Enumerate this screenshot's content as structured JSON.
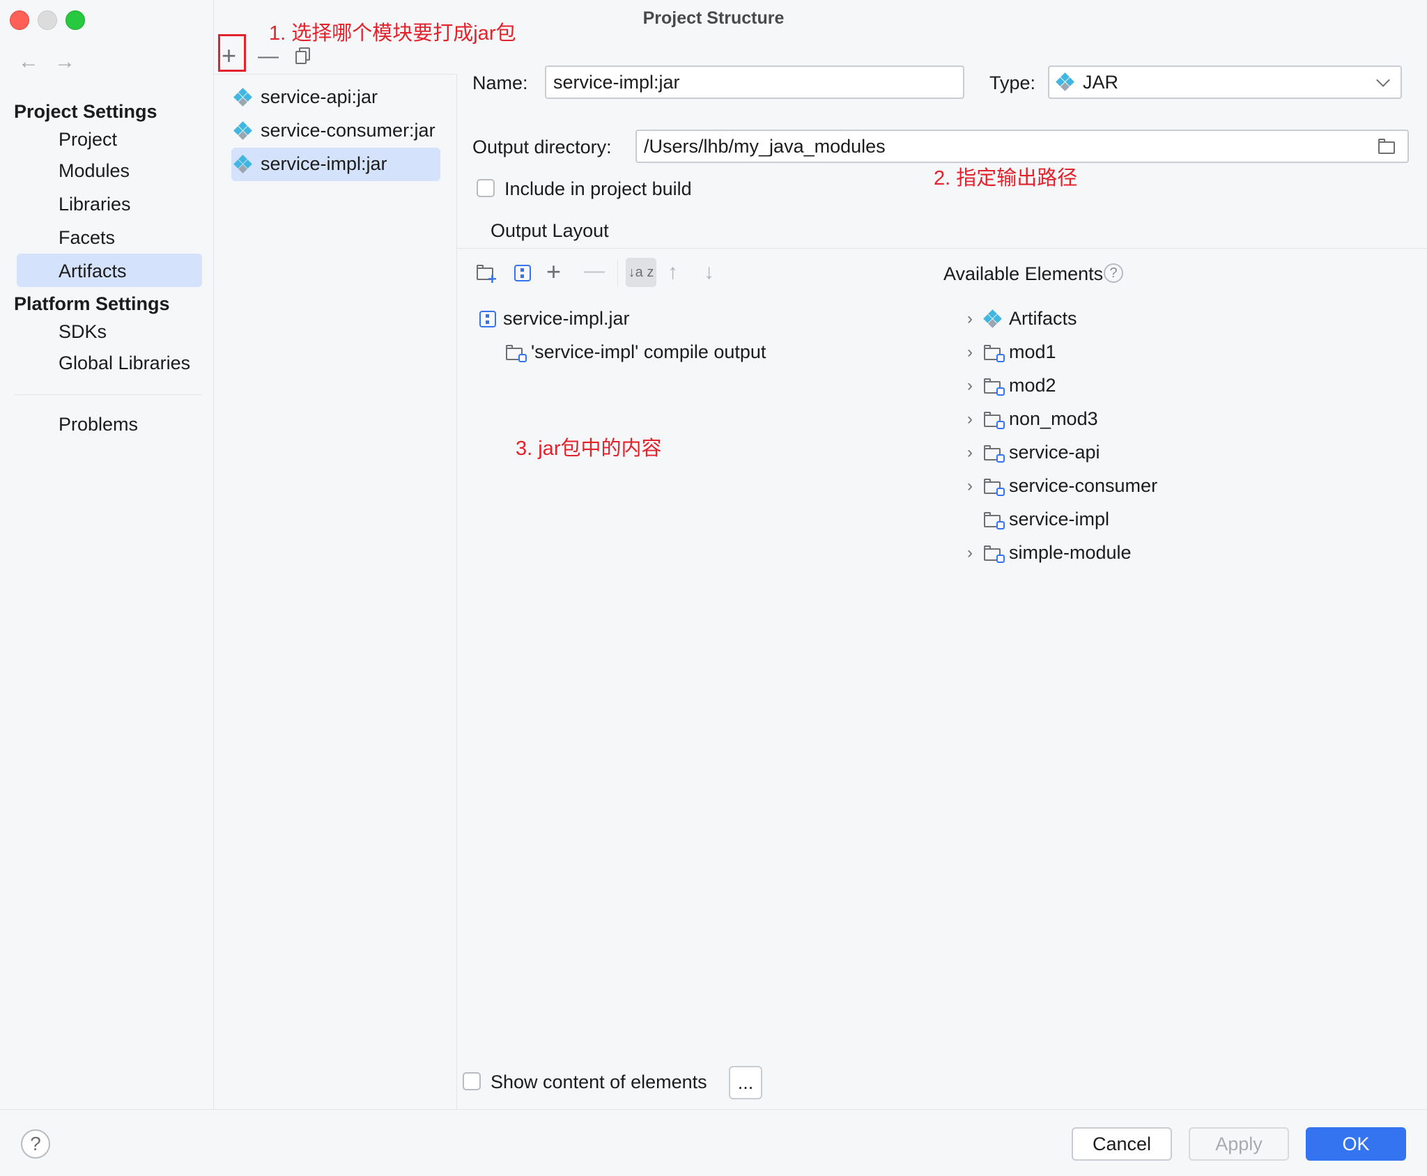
{
  "window": {
    "title": "Project Structure"
  },
  "nav": {
    "back": "←",
    "forward": "→",
    "project_settings": "Project Settings",
    "project_items": [
      "Project",
      "Modules",
      "Libraries",
      "Facets",
      "Artifacts"
    ],
    "platform_settings": "Platform Settings",
    "platform_items": [
      "SDKs",
      "Global Libraries"
    ],
    "problems": "Problems",
    "selected": "Artifacts"
  },
  "artifacts": {
    "toolbar": {
      "add": "+",
      "remove": "—"
    },
    "items": [
      "service-api:jar",
      "service-consumer:jar",
      "service-impl:jar"
    ],
    "selected": "service-impl:jar"
  },
  "form": {
    "name_label": "Name:",
    "name_value": "service-impl:jar",
    "type_label": "Type:",
    "type_value": "JAR",
    "output_dir_label": "Output directory:",
    "output_dir_value": "/Users/lhb/my_java_modules",
    "include_build": "Include in project build",
    "output_layout_tab": "Output Layout"
  },
  "layout": {
    "toolbar": {
      "add": "+",
      "remove": "—",
      "sort": "↓a z",
      "up": "↑",
      "down": "↓"
    },
    "root": "service-impl.jar",
    "child": "'service-impl' compile output"
  },
  "available": {
    "title": "Available Elements",
    "help": "?",
    "items": [
      {
        "label": "Artifacts",
        "kind": "artifact",
        "expandable": true
      },
      {
        "label": "mod1",
        "kind": "module",
        "expandable": true
      },
      {
        "label": "mod2",
        "kind": "module",
        "expandable": true
      },
      {
        "label": "non_mod3",
        "kind": "module",
        "expandable": true
      },
      {
        "label": "service-api",
        "kind": "module",
        "expandable": true
      },
      {
        "label": "service-consumer",
        "kind": "module",
        "expandable": true
      },
      {
        "label": "service-impl",
        "kind": "module",
        "expandable": false
      },
      {
        "label": "simple-module",
        "kind": "module",
        "expandable": true
      }
    ]
  },
  "annotations": {
    "a1": "1. 选择哪个模块要打成jar包",
    "a2": "2. 指定输出路径",
    "a3": "3. jar包中的内容"
  },
  "footer": {
    "show_content": "Show content of elements",
    "ellipsis": "...",
    "help": "?",
    "cancel": "Cancel",
    "apply": "Apply",
    "ok": "OK"
  },
  "colors": {
    "accent": "#3574f0",
    "selection": "#d5e2fb",
    "annotation": "#e4222b"
  }
}
